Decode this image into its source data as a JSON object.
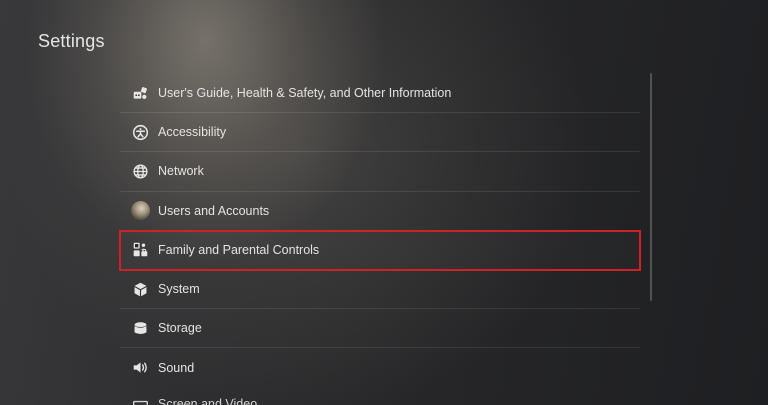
{
  "page": {
    "title": "Settings"
  },
  "menu": {
    "items": [
      {
        "label": "User's Guide, Health & Safety, and Other Information",
        "icon": "guide-icon"
      },
      {
        "label": "Accessibility",
        "icon": "accessibility-icon"
      },
      {
        "label": "Network",
        "icon": "globe-icon"
      },
      {
        "label": "Users and Accounts",
        "icon": "user-avatar"
      },
      {
        "label": "Family and Parental Controls",
        "icon": "family-controls-icon",
        "selected": true
      },
      {
        "label": "System",
        "icon": "cube-icon"
      },
      {
        "label": "Storage",
        "icon": "storage-icon"
      },
      {
        "label": "Sound",
        "icon": "speaker-icon"
      }
    ],
    "partial_item": {
      "label": "Screen and Video",
      "icon": "monitor-icon"
    }
  },
  "colors": {
    "selection_outline": "#d0202a",
    "text": "#e4e4e4"
  }
}
